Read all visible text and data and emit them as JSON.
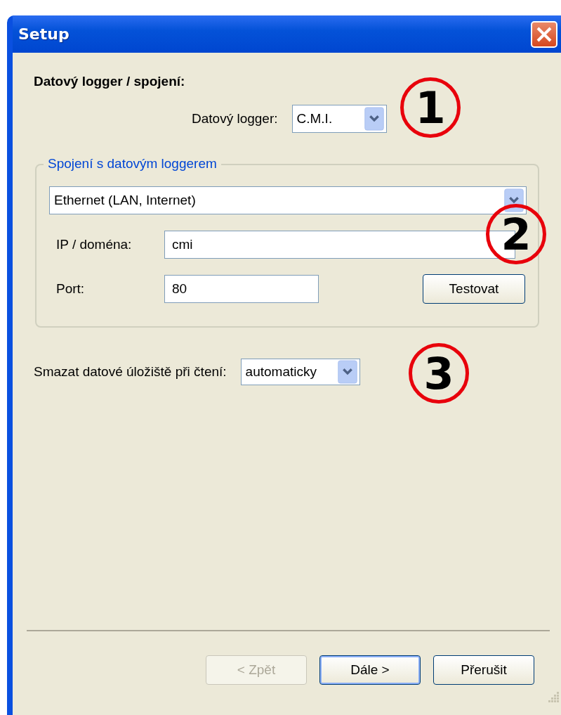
{
  "window": {
    "title": "Setup"
  },
  "heading": "Datový logger / spojení:",
  "logger": {
    "label": "Datový logger:",
    "value": "C.M.I."
  },
  "connection_group": {
    "legend": "Spojení s datovým loggerem",
    "type_value": "Ethernet (LAN, Internet)",
    "ip_label": "IP / doména:",
    "ip_value": "cmi",
    "port_label": "Port:",
    "port_value": "80",
    "test_button": "Testovat"
  },
  "delete_storage": {
    "label": "Smazat datové úložiště při čtení:",
    "value": "automaticky"
  },
  "callouts": [
    "1",
    "2",
    "3"
  ],
  "buttons": [
    {
      "label": "< Zpět",
      "disabled": true,
      "default": false
    },
    {
      "label": "Dále >",
      "disabled": false,
      "default": true
    },
    {
      "label": "Přerušit",
      "disabled": false,
      "default": false
    }
  ]
}
